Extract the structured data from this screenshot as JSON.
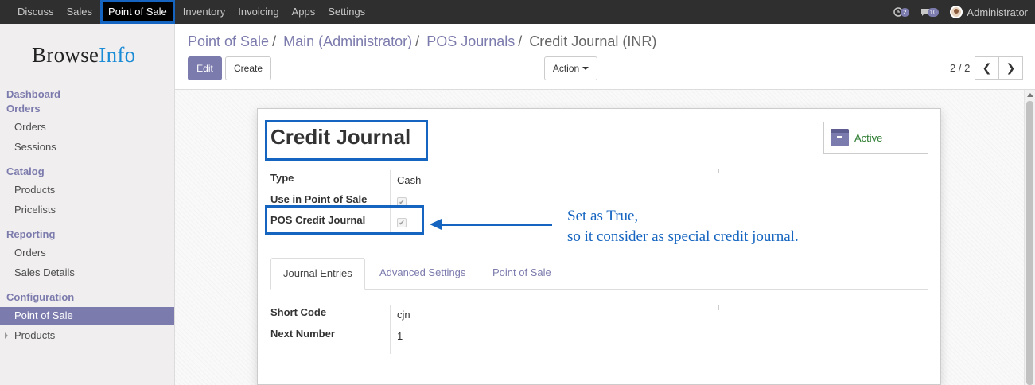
{
  "topbar": {
    "menu": [
      "Discuss",
      "Sales",
      "Point of Sale",
      "Inventory",
      "Invoicing",
      "Apps",
      "Settings"
    ],
    "active_menu": "Point of Sale",
    "messages_count": "2",
    "chat_count": "10",
    "user": "Administrator"
  },
  "sidebar": {
    "logo_main": "Browse",
    "logo_accent": "Info",
    "dashboard": "Dashboard",
    "orders_head": "Orders",
    "orders_items": [
      "Orders",
      "Sessions"
    ],
    "catalog_head": "Catalog",
    "catalog_items": [
      "Products",
      "Pricelists"
    ],
    "reporting_head": "Reporting",
    "reporting_items": [
      "Orders",
      "Sales Details"
    ],
    "config_head": "Configuration",
    "config_items": [
      "Point of Sale",
      "Products"
    ]
  },
  "breadcrumb": {
    "items": [
      "Point of Sale",
      "Main (Administrator)",
      "POS Journals"
    ],
    "current": "Credit Journal (INR)"
  },
  "buttons": {
    "edit": "Edit",
    "create": "Create",
    "action": "Action"
  },
  "pager": {
    "text": "2 / 2",
    "prev": "❮",
    "next": "❯"
  },
  "form": {
    "title": "Credit Journal",
    "active_label": "Active",
    "fields": {
      "type_label": "Type",
      "type_value": "Cash",
      "use_pos_label": "Use in Point of Sale",
      "use_pos_checked": true,
      "pos_credit_label": "POS Credit Journal",
      "pos_credit_checked": true
    },
    "tabs": [
      "Journal Entries",
      "Advanced Settings",
      "Point of Sale"
    ],
    "active_tab": "Journal Entries",
    "short_code_label": "Short Code",
    "short_code_value": "cjn",
    "next_number_label": "Next Number",
    "next_number_value": "1"
  },
  "annotation": {
    "line1": "Set as True,",
    "line2": "so it consider as special credit journal."
  },
  "colors": {
    "accent": "#7c7bad",
    "highlight": "#1464c0",
    "topbar": "#2f2f2f",
    "active_text": "#2e7d32"
  }
}
